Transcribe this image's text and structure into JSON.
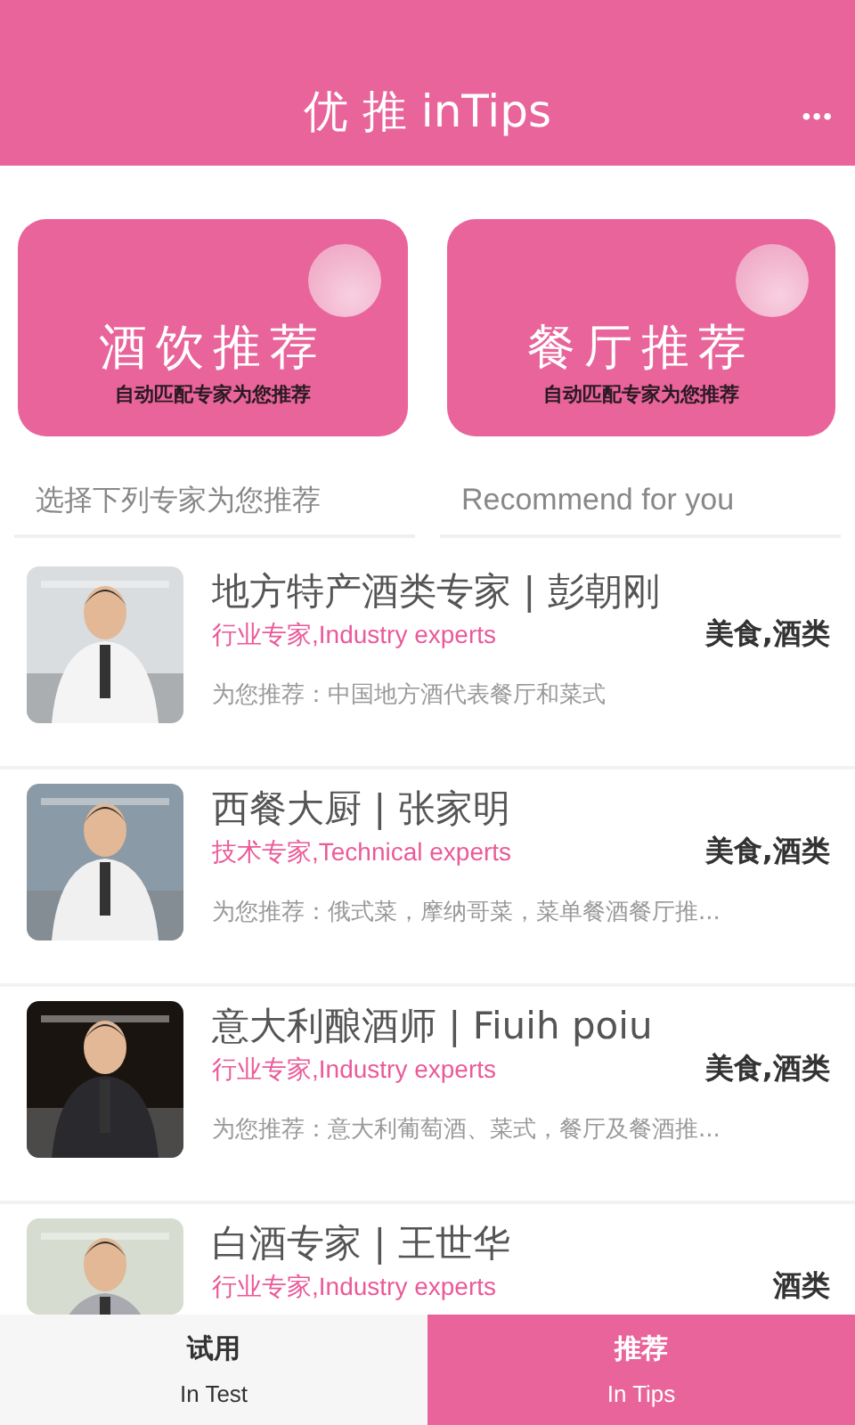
{
  "header": {
    "title": "优 推 inTips",
    "menu": "•••"
  },
  "cards": [
    {
      "title": "酒饮推荐",
      "subtitle": "自动匹配专家为您推荐"
    },
    {
      "title": "餐厅推荐",
      "subtitle": "自动匹配专家为您推荐"
    }
  ],
  "section": {
    "left": "选择下列专家为您推荐",
    "right": "Recommend for you"
  },
  "experts": [
    {
      "name": "地方特产酒类专家 | 彭朝刚",
      "role": "行业专家,Industry experts",
      "tags": "美食,酒类",
      "recommend": "为您推荐：中国地方酒代表餐厅和菜式"
    },
    {
      "name": "西餐大厨 | 张家明",
      "role": "技术专家,Technical experts",
      "tags": "美食,酒类",
      "recommend": "为您推荐：俄式菜，摩纳哥菜，菜单餐酒餐厅推..."
    },
    {
      "name": "意大利酿酒师 | Fiuih poiu",
      "role": "行业专家,Industry experts",
      "tags": "美食,酒类",
      "recommend": "为您推荐：意大利葡萄酒、菜式，餐厅及餐酒推..."
    },
    {
      "name": "白酒专家 | 王世华",
      "role": "行业专家,Industry experts",
      "tags": "酒类"
    }
  ],
  "bottom_tabs": [
    {
      "label": "试用",
      "sublabel": "In Test",
      "selected": false
    },
    {
      "label": "推荐",
      "sublabel": "In Tips",
      "selected": true
    }
  ]
}
